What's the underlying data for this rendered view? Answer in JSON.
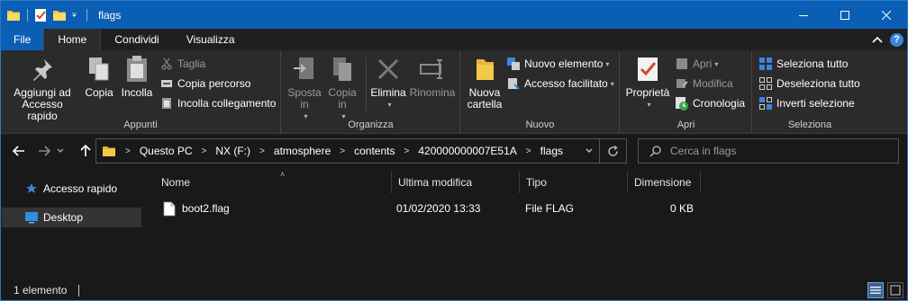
{
  "window": {
    "title": "flags",
    "colors": {
      "titlebar": "#0a5fb4",
      "file_tab": "#0a5fb4",
      "background": "#191919",
      "ribbon": "#2b2b2b",
      "accent_blue": "#3a86d9",
      "folder_yellow": "#f3c94a"
    }
  },
  "qat": {
    "icons": [
      "folder-icon",
      "properties-check-icon",
      "new-folder-icon",
      "customize-dropdown-icon"
    ]
  },
  "tabs": {
    "file": "File",
    "home": "Home",
    "share": "Condividi",
    "view": "Visualizza"
  },
  "ribbon": {
    "clipboard": {
      "label": "Appunti",
      "pin": "Aggiungi ad Accesso rapido",
      "copy": "Copia",
      "paste": "Incolla",
      "cut": "Taglia",
      "copy_path": "Copia percorso",
      "paste_shortcut": "Incolla collegamento"
    },
    "organize": {
      "label": "Organizza",
      "move_to": "Sposta in",
      "copy_to": "Copia in",
      "delete": "Elimina",
      "rename": "Rinomina"
    },
    "new": {
      "label": "Nuovo",
      "new_folder": "Nuova cartella",
      "new_item": "Nuovo elemento",
      "easy_access": "Accesso facilitato"
    },
    "open": {
      "label": "Apri",
      "properties": "Proprietà",
      "open": "Apri",
      "edit": "Modifica",
      "history": "Cronologia"
    },
    "select": {
      "label": "Seleziona",
      "select_all": "Seleziona tutto",
      "select_none": "Deseleziona tutto",
      "invert": "Inverti selezione"
    }
  },
  "address": {
    "crumbs": [
      "Questo PC",
      "NX (F:)",
      "atmosphere",
      "contents",
      "420000000007E51A",
      "flags"
    ]
  },
  "search": {
    "placeholder": "Cerca in flags"
  },
  "navpane": {
    "quick_access": "Accesso rapido",
    "desktop": "Desktop"
  },
  "columns": {
    "name": "Nome",
    "modified": "Ultima modifica",
    "type": "Tipo",
    "size": "Dimensione"
  },
  "files": [
    {
      "name": "boot2.flag",
      "modified": "01/02/2020 13:33",
      "type": "File FLAG",
      "size": "0 KB"
    }
  ],
  "status": {
    "count": "1 elemento"
  }
}
